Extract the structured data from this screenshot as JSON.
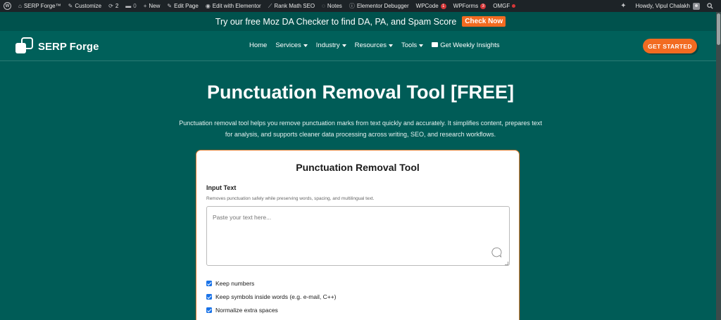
{
  "adminbar": {
    "site_name": "SERP Forge™",
    "customize": "Customize",
    "updates_count": "2",
    "comments_count": "0",
    "new_label": "New",
    "edit_page": "Edit Page",
    "elementor": "Edit with Elementor",
    "rankmath": "Rank Math SEO",
    "notes": "Notes",
    "debugger": "Elementor Debugger",
    "wpcode": "WPCode",
    "wpcode_badge": "1",
    "wpforms": "WPForms",
    "wpforms_badge": "3",
    "omgf": "OMGF",
    "howdy": "Howdy, Vipul Chalakh"
  },
  "promo": {
    "text": "Try our free Moz DA Checker to find DA, PA, and Spam Score",
    "button": "Check Now"
  },
  "header": {
    "logo_text": "SERP Forge",
    "nav": {
      "home": "Home",
      "services": "Services",
      "industry": "Industry",
      "resources": "Resources",
      "tools": "Tools",
      "insights": "Get Weekly Insights"
    },
    "cta": "GET STARTED"
  },
  "hero": {
    "title": "Punctuation Removal Tool [FREE]",
    "description": "Punctuation removal tool helps you remove punctuation marks from text quickly and accurately. It simplifies content, prepares text for analysis, and supports cleaner data processing across writing, SEO, and research workflows."
  },
  "tool": {
    "title": "Punctuation Removal Tool",
    "input_label": "Input Text",
    "input_hint": "Removes punctuation safely while preserving words, spacing, and multilingual text.",
    "input_placeholder": "Paste your text here...",
    "options": [
      {
        "label": "Keep numbers",
        "checked": true
      },
      {
        "label": "Keep symbols inside words (e.g. e-mail, C++)",
        "checked": true
      },
      {
        "label": "Normalize extra spaces",
        "checked": true
      }
    ]
  },
  "colors": {
    "brand_teal": "#005c57",
    "accent_orange": "#f26b21",
    "checkbox_blue": "#1a73e8"
  }
}
